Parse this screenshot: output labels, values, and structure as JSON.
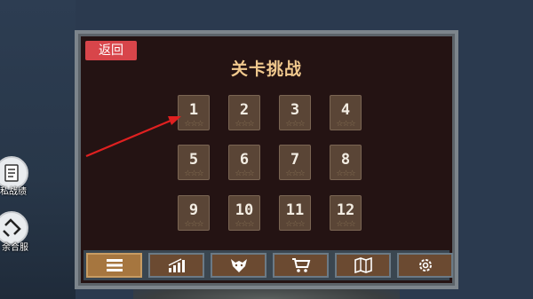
{
  "side": {
    "item1_label": "私战绩",
    "item2_label": "余合服"
  },
  "panel": {
    "back_label": "返回",
    "title": "关卡挑战"
  },
  "levels": [
    "1",
    "2",
    "3",
    "4",
    "5",
    "6",
    "7",
    "8",
    "9",
    "10",
    "11",
    "12"
  ],
  "level_stars": "☆☆☆",
  "toolbar": {
    "items": [
      "menu-icon",
      "stats-icon",
      "wolf-icon",
      "cart-icon",
      "map-icon",
      "settings-icon"
    ],
    "active_index": 0
  },
  "colors": {
    "accent_title": "#f1c98e",
    "back_button": "#d8454a",
    "arrow": "#e02020"
  }
}
